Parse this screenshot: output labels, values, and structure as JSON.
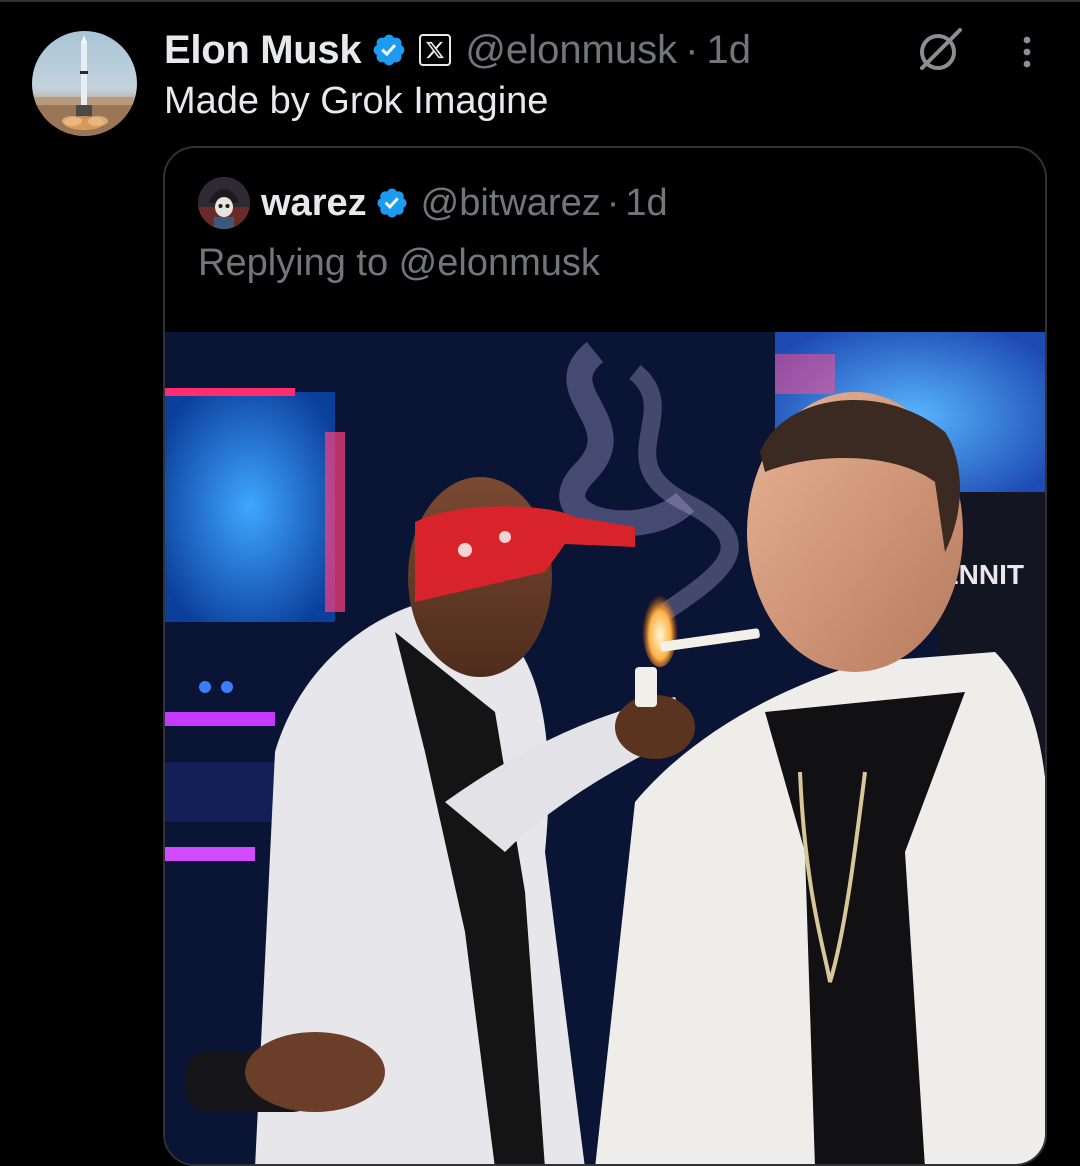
{
  "tweet": {
    "author_name": "Elon Musk",
    "author_handle": "@elonmusk",
    "separator": "·",
    "time": "1d",
    "text": "Made by Grok Imagine",
    "icons": {
      "verified": "verified-badge-icon",
      "affiliation": "x-logo-icon",
      "grok": "grok-icon",
      "more": "more-vertical-icon"
    }
  },
  "quote": {
    "author_name": "warez",
    "author_handle": "@bitwarez",
    "separator": "·",
    "time": "1d",
    "reply_text": "Replying to @elonmusk",
    "media": {
      "kind": "generated-image",
      "chair_text": "ENNIT"
    }
  },
  "colors": {
    "background": "#000000",
    "primary_text": "#e7e9ea",
    "secondary_text": "#71767b",
    "verified_blue": "#1d9bf0",
    "border": "#2f3336"
  }
}
